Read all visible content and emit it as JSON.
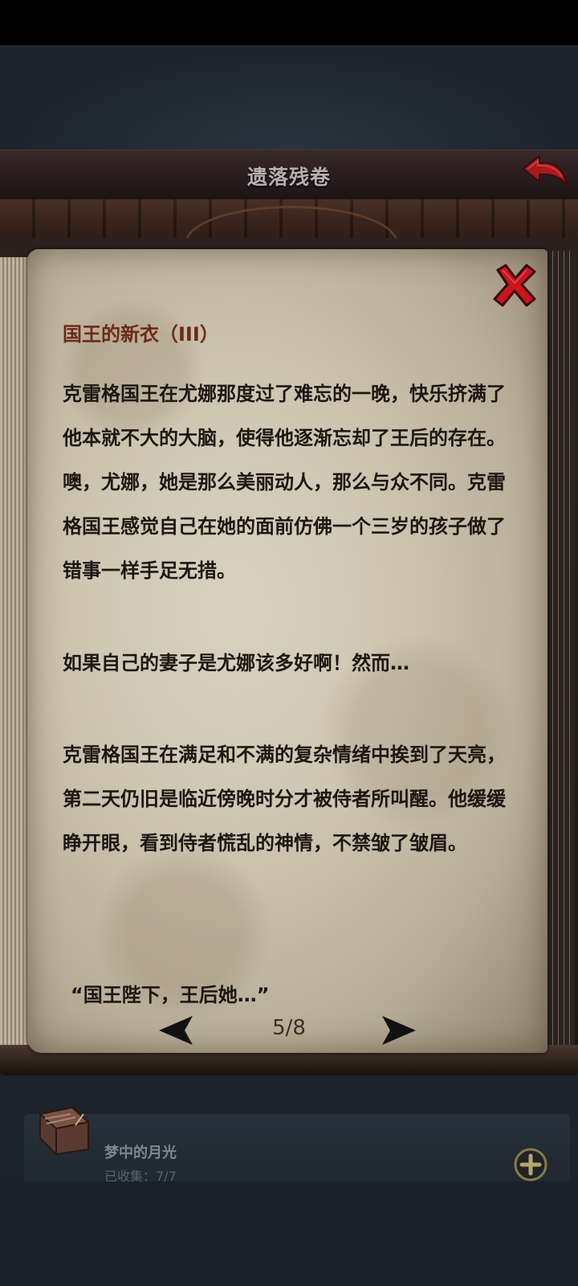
{
  "header": {
    "title": "遗落残卷"
  },
  "document": {
    "title": "国王的新衣（III）",
    "paragraphs": [
      "克雷格国王在尤娜那度过了难忘的一晚，快乐挤满了他本就不大的大脑，使得他逐渐忘却了王后的存在。噢，尤娜，她是那么美丽动人，那么与众不同。克雷格国王感觉自己在她的面前仿佛一个三岁的孩子做了错事一样手足无措。",
      "如果自己的妻子是尤娜该多好啊！然而…",
      "克雷格国王在满足和不满的复杂情绪中挨到了天亮，第二天仍旧是临近傍晚时分才被侍者所叫醒。他缓缓睁开眼，看到侍者慌乱的神情，不禁皱了皱眉。"
    ],
    "quote": "“国王陛下，王后她…”"
  },
  "pager": {
    "indicator": "5/8",
    "current": 5,
    "total": 8
  },
  "collection": {
    "item_name": "梦中的月光",
    "item_progress": "已收集：7/7"
  },
  "colors": {
    "title_red": "#6e2a16",
    "close_red": "#c8161d",
    "back_red": "#a81a1e"
  },
  "icons": {
    "back": "back-arrow-icon",
    "close": "close-x-icon",
    "prev": "prev-arrow-icon",
    "next": "next-arrow-icon",
    "add": "plus-circle-icon",
    "book": "book-icon"
  }
}
